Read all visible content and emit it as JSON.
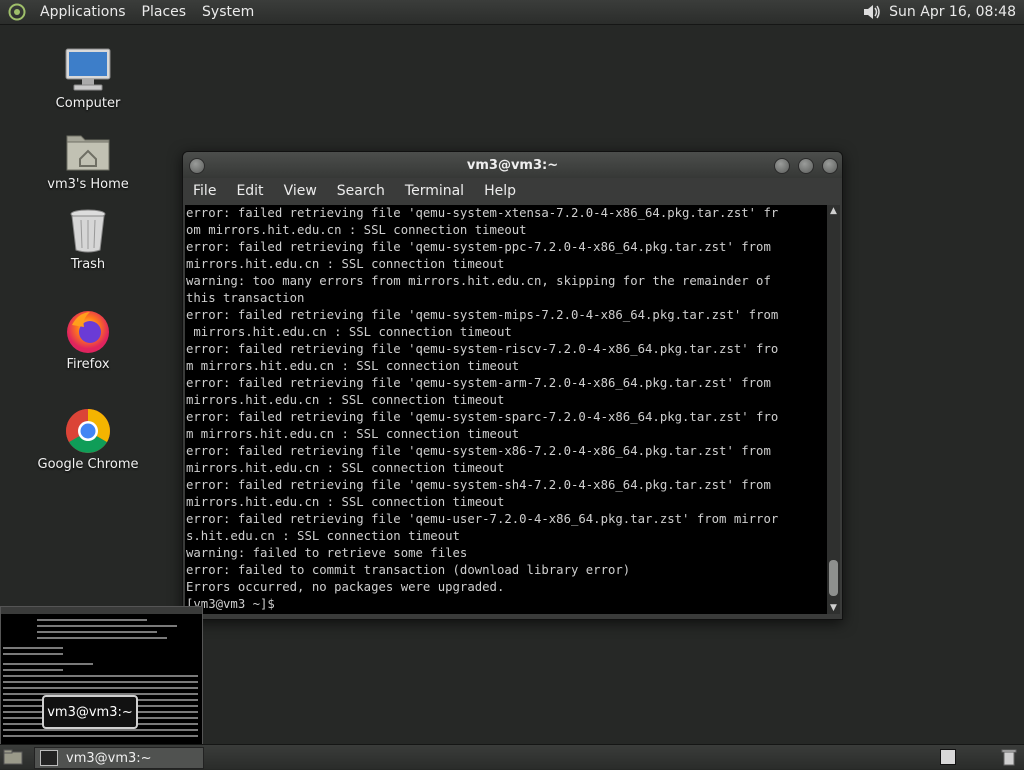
{
  "top_panel": {
    "menus": [
      "Applications",
      "Places",
      "System"
    ],
    "clock": "Sun Apr 16, 08:48",
    "icons": [
      "distro-logo-icon",
      "volume-icon"
    ]
  },
  "desktop": {
    "icons": [
      {
        "label": "Computer",
        "icon": "computer-icon"
      },
      {
        "label": "vm3's Home",
        "icon": "home-folder-icon"
      },
      {
        "label": "Trash",
        "icon": "trash-icon"
      },
      {
        "label": "Firefox",
        "icon": "firefox-icon"
      },
      {
        "label": "Google Chrome",
        "icon": "chrome-icon"
      }
    ]
  },
  "terminal": {
    "title": "vm3@vm3:~",
    "menu": [
      "File",
      "Edit",
      "View",
      "Search",
      "Terminal",
      "Help"
    ],
    "lines": [
      "error: failed retrieving file 'qemu-system-xtensa-7.2.0-4-x86_64.pkg.tar.zst' fr",
      "om mirrors.hit.edu.cn : SSL connection timeout",
      "error: failed retrieving file 'qemu-system-ppc-7.2.0-4-x86_64.pkg.tar.zst' from",
      "mirrors.hit.edu.cn : SSL connection timeout",
      "warning: too many errors from mirrors.hit.edu.cn, skipping for the remainder of",
      "this transaction",
      "error: failed retrieving file 'qemu-system-mips-7.2.0-4-x86_64.pkg.tar.zst' from",
      " mirrors.hit.edu.cn : SSL connection timeout",
      "error: failed retrieving file 'qemu-system-riscv-7.2.0-4-x86_64.pkg.tar.zst' fro",
      "m mirrors.hit.edu.cn : SSL connection timeout",
      "error: failed retrieving file 'qemu-system-arm-7.2.0-4-x86_64.pkg.tar.zst' from",
      "mirrors.hit.edu.cn : SSL connection timeout",
      "error: failed retrieving file 'qemu-system-sparc-7.2.0-4-x86_64.pkg.tar.zst' fro",
      "m mirrors.hit.edu.cn : SSL connection timeout",
      "error: failed retrieving file 'qemu-system-x86-7.2.0-4-x86_64.pkg.tar.zst' from",
      "mirrors.hit.edu.cn : SSL connection timeout",
      "error: failed retrieving file 'qemu-system-sh4-7.2.0-4-x86_64.pkg.tar.zst' from",
      "mirrors.hit.edu.cn : SSL connection timeout",
      "error: failed retrieving file 'qemu-user-7.2.0-4-x86_64.pkg.tar.zst' from mirror",
      "s.hit.edu.cn : SSL connection timeout",
      "warning: failed to retrieve some files",
      "error: failed to commit transaction (download library error)",
      "Errors occurred, no packages were upgraded.",
      "[vm3@vm3 ~]$ "
    ]
  },
  "preview_tooltip": "vm3@vm3:~",
  "bottom_panel": {
    "task_label": "vm3@vm3:~"
  }
}
